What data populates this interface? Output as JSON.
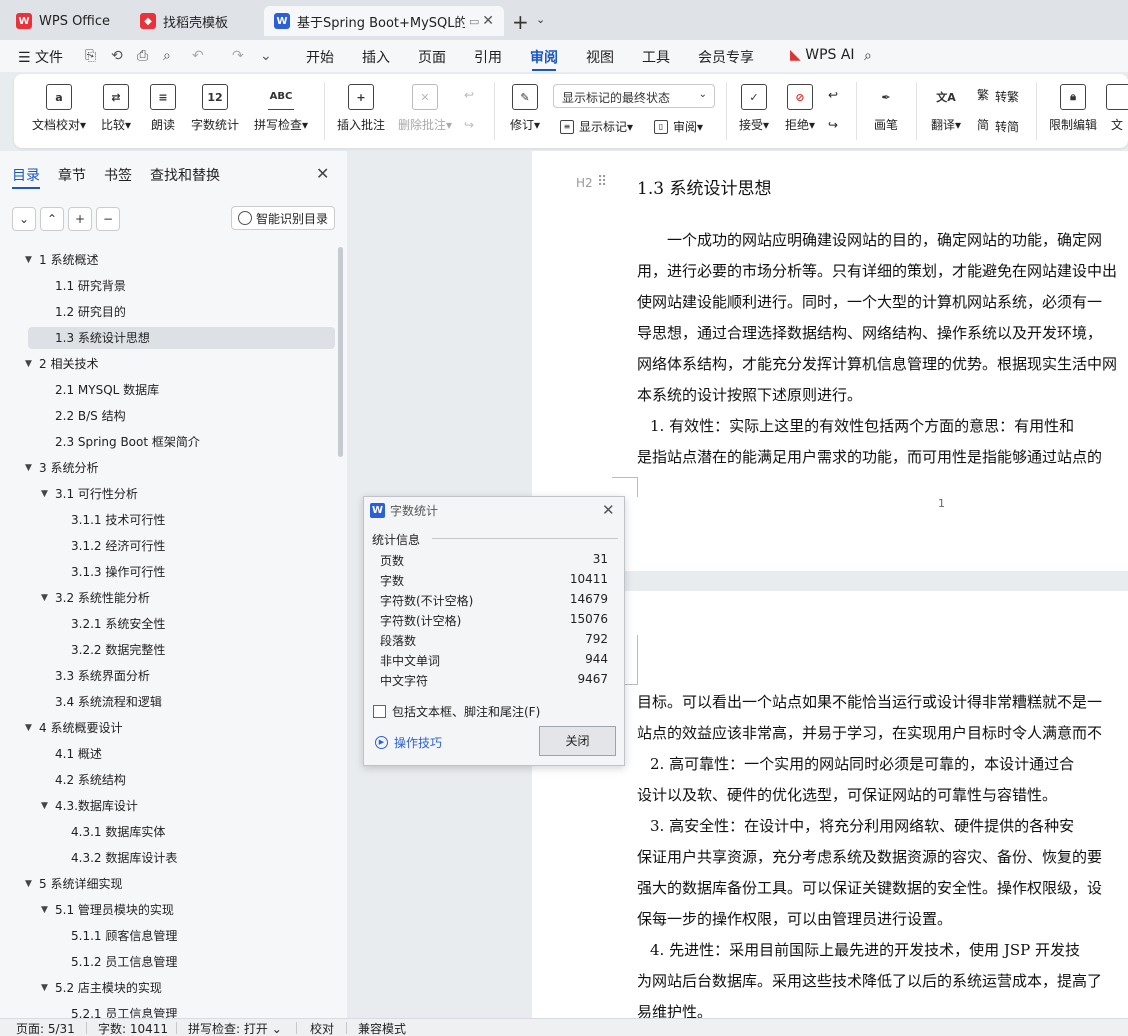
{
  "tabs": [
    {
      "label": "WPS Office",
      "icon": "wps-logo-icon"
    },
    {
      "label": "找稻壳模板",
      "icon": "docer-icon"
    },
    {
      "label": "基于Spring Boot+MySQL的",
      "icon": "word-doc-icon",
      "active": true
    }
  ],
  "menu": {
    "file": "文件",
    "items": [
      "开始",
      "插入",
      "页面",
      "引用",
      "审阅",
      "视图",
      "工具",
      "会员专享"
    ],
    "active": "审阅",
    "ai": "WPS AI"
  },
  "ribbon": {
    "doc_check": "文档校对",
    "compare": "比较",
    "read_aloud": "朗读",
    "word_count": "字数统计",
    "word_count_icon_text": "12",
    "spell_check": "拼写检查",
    "spell_icon_text": "ABC",
    "insert_comment": "插入批注",
    "delete_comment": "删除批注",
    "revise": "修订",
    "markup_select": "显示标记的最终状态",
    "show_markup": "显示标记",
    "review": "审阅",
    "accept": "接受",
    "reject": "拒绝",
    "pen": "画笔",
    "translate": "翻译",
    "to_traditional": "转繁",
    "to_simplified": "转简",
    "restrict_edit": "限制编辑",
    "doc_partial": "文"
  },
  "nav": {
    "tabs": [
      "目录",
      "章节",
      "书签",
      "查找和替换"
    ],
    "active_tab": "目录",
    "smart_toc": "智能识别目录",
    "toc": [
      {
        "text": "1 系统概述",
        "level": 1,
        "expanded": true
      },
      {
        "text": "1.1  研究背景",
        "level": 2
      },
      {
        "text": "1.2 研究目的",
        "level": 2
      },
      {
        "text": "1.3 系统设计思想",
        "level": 2,
        "selected": true
      },
      {
        "text": "2 相关技术",
        "level": 1,
        "expanded": true
      },
      {
        "text": "2.1 MYSQL 数据库",
        "level": 2
      },
      {
        "text": "2.2 B/S 结构",
        "level": 2
      },
      {
        "text": "2.3 Spring Boot 框架简介",
        "level": 2
      },
      {
        "text": "3 系统分析",
        "level": 1,
        "expanded": true
      },
      {
        "text": "3.1 可行性分析",
        "level": 2,
        "expanded": true
      },
      {
        "text": "3.1.1 技术可行性",
        "level": 3
      },
      {
        "text": "3.1.2 经济可行性",
        "level": 3
      },
      {
        "text": "3.1.3 操作可行性",
        "level": 3
      },
      {
        "text": "3.2 系统性能分析",
        "level": 2,
        "expanded": true
      },
      {
        "text": "3.2.1  系统安全性",
        "level": 3
      },
      {
        "text": "3.2.2  数据完整性",
        "level": 3
      },
      {
        "text": "3.3 系统界面分析",
        "level": 2
      },
      {
        "text": "3.4 系统流程和逻辑",
        "level": 2
      },
      {
        "text": "4 系统概要设计",
        "level": 1,
        "expanded": true
      },
      {
        "text": "4.1 概述",
        "level": 2
      },
      {
        "text": "4.2 系统结构",
        "level": 2
      },
      {
        "text": "4.3.数据库设计",
        "level": 2,
        "expanded": true
      },
      {
        "text": "4.3.1 数据库实体",
        "level": 3
      },
      {
        "text": "4.3.2 数据库设计表",
        "level": 3
      },
      {
        "text": "5 系统详细实现",
        "level": 1,
        "expanded": true
      },
      {
        "text": "5.1  管理员模块的实现",
        "level": 2,
        "expanded": true
      },
      {
        "text": "5.1.1  顾客信息管理",
        "level": 3
      },
      {
        "text": "5.1.2  员工信息管理",
        "level": 3
      },
      {
        "text": "5.2  店主模块的实现",
        "level": 2,
        "expanded": true
      },
      {
        "text": "5.2.1  员工信息管理",
        "level": 3
      }
    ]
  },
  "document": {
    "heading_marker": "H2",
    "heading": "1.3 系统设计思想",
    "page1_lines": [
      "一个成功的网站应明确建设网站的目的，确定网站的功能，确定网",
      "用，进行必要的市场分析等。只有详细的策划，才能避免在网站建设中出",
      "使网站建设能顺利进行。同时，一个大型的计算机网站系统，必须有一",
      "导思想，通过合理选择数据结构、网络结构、操作系统以及开发环境，",
      "网络体系结构，才能充分发挥计算机信息管理的优势。根据现实生活中网",
      "本系统的设计按照下述原则进行。",
      "1.      有效性：实际上这里的有效性包括两个方面的意思：有用性和",
      "是指站点潜在的能满足用户需求的功能，而可用性是指能够通过站点的"
    ],
    "page_number": "1",
    "page2_lines": [
      "目标。可以看出一个站点如果不能恰当运行或设计得非常糟糕就不是一",
      "站点的效益应该非常高，并易于学习，在实现用户目标时令人满意而不",
      "2.      高可靠性：一个实用的网站同时必须是可靠的，本设计通过合",
      "设计以及软、硬件的优化选型，可保证网站的可靠性与容错性。",
      "3.      高安全性：在设计中，将充分利用网络软、硬件提供的各种安",
      "保证用户共享资源，充分考虑系统及数据资源的容灾、备份、恢复的要",
      "强大的数据库备份工具。可以保证关键数据的安全性。操作权限级，设",
      "保每一步的操作权限，可以由管理员进行设置。",
      "4.      先进性：采用目前国际上最先进的开发技术，使用 JSP 开发技",
      "为网站后台数据库。采用这些技术降低了以后的系统运营成本，提高了",
      "易维护性。"
    ]
  },
  "dialog": {
    "title": "字数统计",
    "section": "统计信息",
    "stats": [
      {
        "label": "页数",
        "value": "31"
      },
      {
        "label": "字数",
        "value": "10411"
      },
      {
        "label": "字符数(不计空格)",
        "value": "14679"
      },
      {
        "label": "字符数(计空格)",
        "value": "15076"
      },
      {
        "label": "段落数",
        "value": "792"
      },
      {
        "label": "非中文单词",
        "value": "944"
      },
      {
        "label": "中文字符",
        "value": "9467"
      }
    ],
    "checkbox": "包括文本框、脚注和尾注(F)",
    "checkbox_checked": false,
    "tips": "操作技巧",
    "close": "关闭"
  },
  "status": {
    "page": "页面: 5/31",
    "words": "字数: 10411",
    "spell": "拼写检查: 打开",
    "proof": "校对",
    "compat": "兼容模式"
  }
}
